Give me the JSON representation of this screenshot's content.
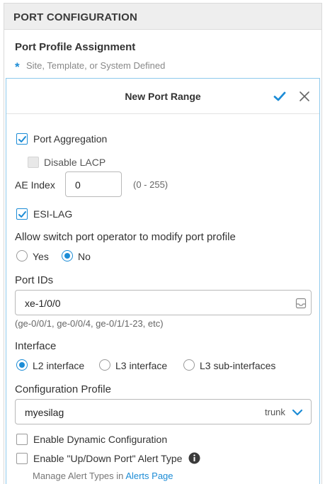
{
  "section": {
    "title": "PORT CONFIGURATION"
  },
  "port_profile": {
    "title": "Port Profile Assignment",
    "hint": "Site, Template, or System Defined"
  },
  "panel": {
    "title": "New Port Range",
    "port_aggregation": {
      "label": "Port Aggregation",
      "checked": true
    },
    "disable_lacp": {
      "label": "Disable LACP",
      "checked": false,
      "disabled": true
    },
    "ae_index": {
      "label": "AE Index",
      "value": "0",
      "range": "(0 - 255)"
    },
    "esi_lag": {
      "label": "ESI-LAG",
      "checked": true
    },
    "allow_modify": {
      "label": "Allow switch port operator to modify port profile",
      "options": [
        {
          "label": "Yes",
          "selected": false
        },
        {
          "label": "No",
          "selected": true
        }
      ]
    },
    "port_ids": {
      "label": "Port IDs",
      "value": "xe-1/0/0",
      "hint": "(ge-0/0/1, ge-0/0/4, ge-0/1/1-23, etc)"
    },
    "interface": {
      "label": "Interface",
      "options": [
        {
          "label": "L2 interface",
          "selected": true
        },
        {
          "label": "L3 interface",
          "selected": false
        },
        {
          "label": "L3 sub-interfaces",
          "selected": false
        }
      ]
    },
    "configuration_profile": {
      "label": "Configuration Profile",
      "value": "myesilag",
      "tag": "trunk"
    },
    "dynamic_config": {
      "label": "Enable Dynamic Configuration",
      "checked": false
    },
    "alert_type": {
      "label": "Enable \"Up/Down Port\" Alert Type",
      "checked": false
    },
    "manage_alerts": {
      "prefix": "Manage Alert Types in",
      "link": "Alerts Page"
    }
  },
  "colors": {
    "accent": "#1c8cd6",
    "header_bg": "#eeeeee",
    "panel_border": "#8dc9ec"
  }
}
